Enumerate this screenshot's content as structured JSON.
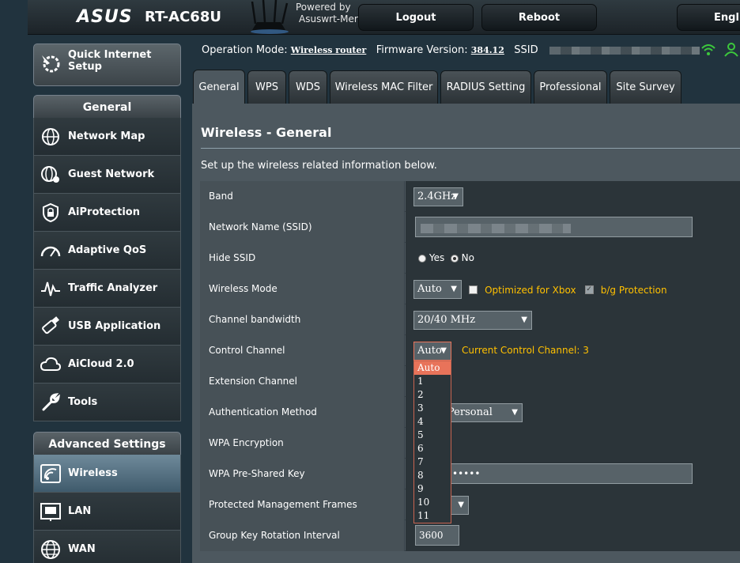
{
  "header": {
    "brand": "ASUS",
    "model": "RT-AC68U",
    "powered_line1": "Powered by",
    "powered_line2": "Asuswrt-Merlin",
    "logout": "Logout",
    "reboot": "Reboot",
    "language": "Engli"
  },
  "opbar": {
    "op_mode_label": "Operation Mode:",
    "op_mode_value": "Wireless router",
    "firmware_label": "Firmware Version:",
    "firmware_value": "384.12",
    "ssid_label": "SSID"
  },
  "sidebar": {
    "quick_setup": "Quick Internet Setup",
    "general_header": "General",
    "general_items": [
      {
        "label": "Network Map",
        "icon": "network-map-icon"
      },
      {
        "label": "Guest Network",
        "icon": "guest-network-icon"
      },
      {
        "label": "AiProtection",
        "icon": "aiprotection-icon"
      },
      {
        "label": "Adaptive QoS",
        "icon": "adaptive-qos-icon"
      },
      {
        "label": "Traffic Analyzer",
        "icon": "traffic-analyzer-icon"
      },
      {
        "label": "USB Application",
        "icon": "usb-application-icon"
      },
      {
        "label": "AiCloud 2.0",
        "icon": "aicloud-icon"
      },
      {
        "label": "Tools",
        "icon": "tools-icon"
      }
    ],
    "advanced_header": "Advanced Settings",
    "advanced_items": [
      {
        "label": "Wireless",
        "icon": "wireless-icon",
        "active": true
      },
      {
        "label": "LAN",
        "icon": "lan-icon"
      },
      {
        "label": "WAN",
        "icon": "wan-icon"
      }
    ]
  },
  "tabs": [
    "General",
    "WPS",
    "WDS",
    "Wireless MAC Filter",
    "RADIUS Setting",
    "Professional",
    "Site Survey"
  ],
  "main": {
    "title": "Wireless - General",
    "description": "Set up the wireless related information below.",
    "rows": {
      "band": {
        "label": "Band",
        "value": "2.4GHz"
      },
      "ssid": {
        "label": "Network Name (SSID)"
      },
      "hide_ssid": {
        "label": "Hide SSID",
        "yes": "Yes",
        "no": "No"
      },
      "wireless_mode": {
        "label": "Wireless Mode",
        "value": "Auto",
        "xbox": "Optimized for Xbox",
        "bg": "b/g Protection"
      },
      "bandwidth": {
        "label": "Channel bandwidth",
        "value": "20/40 MHz"
      },
      "control_channel": {
        "label": "Control Channel",
        "value": "Auto",
        "current": "Current Control Channel: 3"
      },
      "extension_channel": {
        "label": "Extension Channel"
      },
      "auth_method": {
        "label": "Authentication Method",
        "value": "Personal"
      },
      "wpa_encryption": {
        "label": "WPA Encryption"
      },
      "wpa_key": {
        "label": "WPA Pre-Shared Key",
        "value": "•••••"
      },
      "pmf": {
        "label": "Protected Management Frames"
      },
      "group_key": {
        "label": "Group Key Rotation Interval",
        "value": "3600"
      }
    }
  },
  "channel_dropdown": [
    "Auto",
    "1",
    "2",
    "3",
    "4",
    "5",
    "6",
    "7",
    "8",
    "9",
    "10",
    "11"
  ],
  "colors": {
    "accent_orange": "#ffc000",
    "dropdown_highlight": "#e8735a",
    "active_nav": "#4f6b7c"
  }
}
